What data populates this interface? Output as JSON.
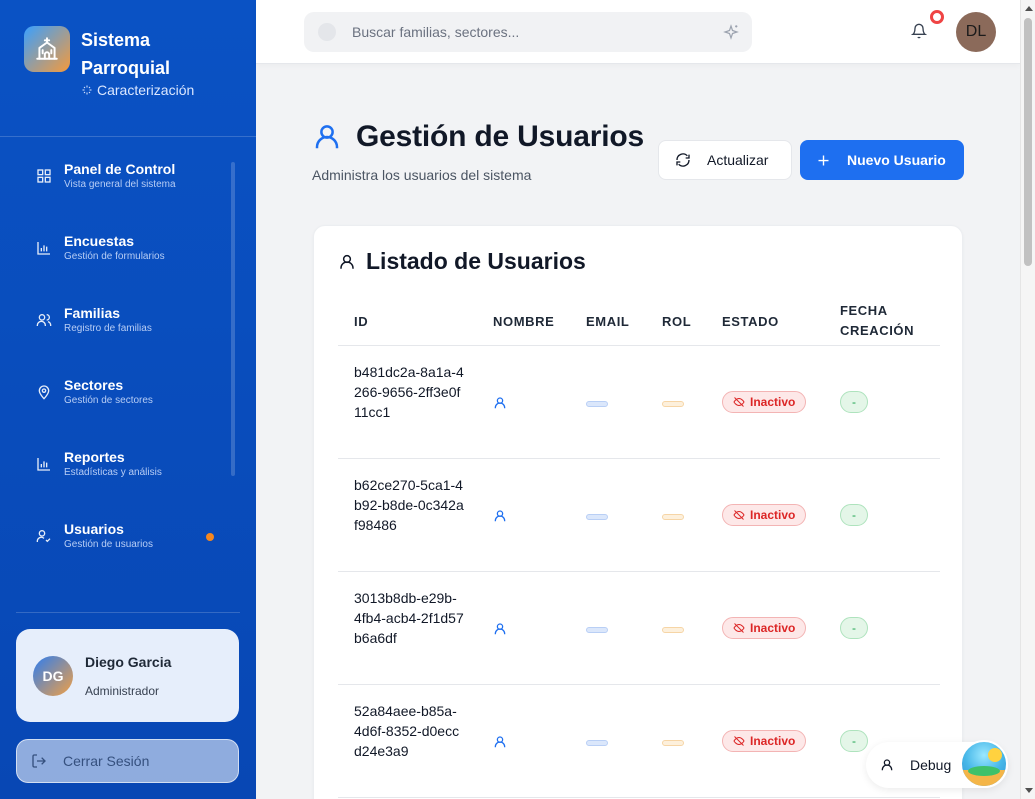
{
  "brand": {
    "title": "Sistema Parroquial",
    "subtitle": "Caracterización"
  },
  "nav": {
    "items": [
      {
        "label": "Panel de Control",
        "sub": "Vista general del sistema",
        "icon": "grid-icon"
      },
      {
        "label": "Encuestas",
        "sub": "Gestión de formularios",
        "icon": "bar-chart-icon"
      },
      {
        "label": "Familias",
        "sub": "Registro de familias",
        "icon": "users-icon"
      },
      {
        "label": "Sectores",
        "sub": "Gestión de sectores",
        "icon": "map-pin-icon"
      },
      {
        "label": "Reportes",
        "sub": "Estadísticas y análisis",
        "icon": "bar-chart-icon"
      },
      {
        "label": "Usuarios",
        "sub": "Gestión de usuarios",
        "icon": "user-check-icon"
      }
    ],
    "active": "Usuarios"
  },
  "user": {
    "initials": "DG",
    "name": "Diego Garcia",
    "role": "Administrador"
  },
  "logout_label": "Cerrar Sesión",
  "search": {
    "placeholder": "Buscar familias, sectores..."
  },
  "top_avatar": "DL",
  "page": {
    "title": "Gestión de Usuarios",
    "subtitle": "Administra los usuarios del sistema",
    "refresh_label": "Actualizar",
    "new_label": "Nuevo Usuario"
  },
  "card": {
    "title": "Listado de Usuarios"
  },
  "table": {
    "headers": {
      "id": "ID",
      "nombre": "NOMBRE",
      "email": "EMAIL",
      "rol": "ROL",
      "estado": "ESTADO",
      "fecha_1": "FECHA",
      "fecha_2": "CREACIÓN"
    },
    "rows": [
      {
        "id": "b481dc2a-8a1a-4266-9656-2ff3e0f11cc1",
        "estado": "Inactivo",
        "fecha": "-"
      },
      {
        "id": "b62ce270-5ca1-4b92-b8de-0c342af98486",
        "estado": "Inactivo",
        "fecha": "-"
      },
      {
        "id": "3013b8db-e29b-4fb4-acb4-2f1d57b6a6df",
        "estado": "Inactivo",
        "fecha": "-"
      },
      {
        "id": "52a84aee-b85a-4d6f-8352-d0eccd24e3a9",
        "estado": "Inactivo",
        "fecha": "-"
      }
    ]
  },
  "debug_label": "Debug",
  "colors": {
    "sidebar": "#0a52c4",
    "primary": "#1e6ff0",
    "status_inactive": "#dc2626",
    "badge_dot": "#f5871f"
  }
}
